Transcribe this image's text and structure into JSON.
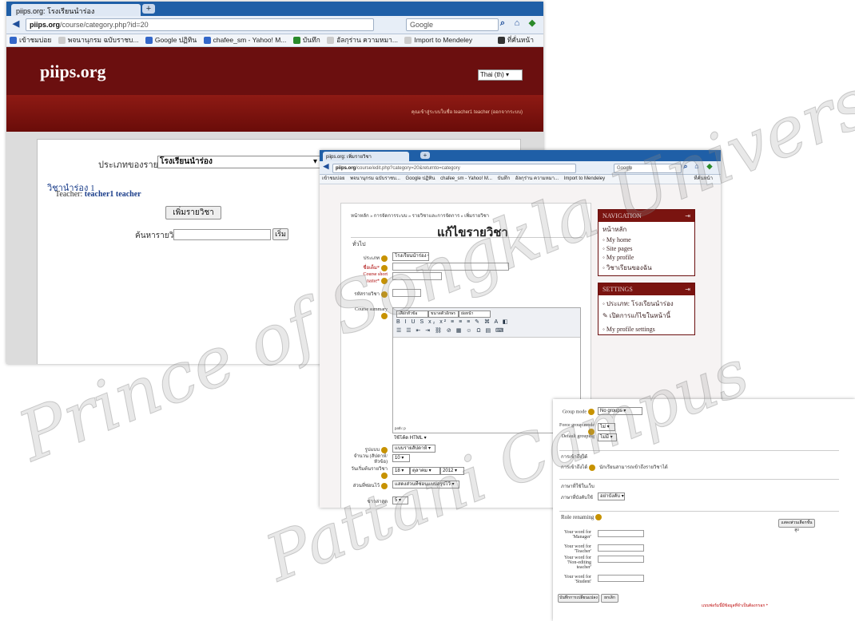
{
  "shot1": {
    "tab_title": "piips.org: โรงเรียนนำร่อง",
    "url_domain": "piips.org",
    "url_path": "/course/category.php?id=20",
    "search_placeholder": "Google",
    "bookmarks": [
      "เข้าชมบ่อย",
      "พจนานุกรม ฉบับราชบ...",
      "Google ปฏิทิน",
      "chafee_sm - Yahoo! M...",
      "บันทึก",
      "อัลกุร่าน ความหมา...",
      "Import to Mendeley",
      "ที่คั่นหน้า"
    ],
    "site_name": "piips.org",
    "language": "Thai (th)",
    "login_info": "คุณเข้าสู่ระบบในชื่อ teacher1 teacher (ออกจากระบบ)",
    "category_label": "ประเภทของรายวิชา:",
    "category_value": "โรงเรียนนำร่อง",
    "course_name": "วิชานำร่อง 1",
    "teacher_label": "Teacher:",
    "teacher_name": "teacher1 teacher",
    "add_course_button": "เพิ่มรายวิชา",
    "search_courses_label": "ค้นหารายวิชา:",
    "go_button": "เริ่ม"
  },
  "shot2": {
    "tab_title": "piips.org: เพิ่มรายวิชา",
    "url_domain": "piips.org",
    "url_path": "/course/edit.php?category=20&returnto=category",
    "search_placeholder": "Google",
    "bookmarks": [
      "เข้าชมบ่อย",
      "พจนานุกรม ฉบับราชบ...",
      "Google ปฏิทิน",
      "chafee_sm - Yahoo! M...",
      "บันทึก",
      "อัลกุร่าน ความหมา...",
      "Import to Mendeley",
      "ที่คั่นหน้า"
    ],
    "breadcrumb": "หน้าหลัก » การจัดการระบบ » รายวิชาและการจัดการ » เพิ่มรายวิชา",
    "page_title": "แก้ไขรายวิชา",
    "section_general": "ทั่วไป",
    "fields": {
      "category_label": "ประเภท",
      "category_value": "โรงเรียนนำร่อง",
      "fullname_label": "ชื่อเต็ม*",
      "shortname_label": "Course short name*",
      "idnumber_label": "รหัสรายวิชา",
      "summary_label": "Course summary",
      "path_label": "path: p",
      "format_text_value": "ใช้โค้ด HTML",
      "format_label": "รูปแบบ",
      "format_value": "แบบรายสัปดาห์",
      "sections_label": "จำนวน (สัปดาห์/หัวข้อ)",
      "sections_value": "10",
      "startdate_label": "วันเริ่มต้นรายวิชา",
      "start_day": "18",
      "start_month": "ตุลาคม",
      "start_year": "2012",
      "hidden_label": "ส่วนที่ซ่อนไว้",
      "hidden_value": "แสดงส่วนที่ซ่อนแบบสรุปไว้",
      "news_label": "ข่าวล่าสุด",
      "news_value": "5"
    },
    "editor_dropdowns": [
      "เลือกหัวข้อ",
      "ขนาดตัวอักษร",
      "ย่อหน้า"
    ],
    "nav_block": {
      "title": "NAVIGATION",
      "items": [
        "หน้าหลัก",
        "My home",
        "Site pages",
        "My profile",
        "วิชาเรียนของฉัน"
      ]
    },
    "settings_block": {
      "title": "SETTINGS",
      "items": [
        "ประเภท: โรงเรียนนำร่อง",
        "เปิดการแก้ไขในหน้านี้",
        "My profile settings"
      ]
    }
  },
  "shot3": {
    "group_mode_label": "Group mode",
    "group_mode_value": "No groups",
    "force_label": "Force group mode",
    "force_value": "ไม่",
    "default_grouping_label": "Default grouping",
    "default_grouping_value": "ไม่มี",
    "availability_section": "การเข้าถึงได้",
    "availability_label": "การเข้าถึงได้",
    "availability_value": "นักเรียนสามารถเข้าถึงรายวิชาได้",
    "language_section": "ภาษาที่ใช้ในเว็บ",
    "force_language_label": "ภาษาที่บังคับใช้",
    "force_language_value": "อย่าบังคับ",
    "role_renaming_section": "Role renaming",
    "show_advanced_button": "แสดงส่วนเลือกขั้นสูง",
    "role_labels": [
      "Your word for 'Manager'",
      "Your word for 'Teacher'",
      "Your word for 'Non-editing teacher'",
      "Your word for 'Student'"
    ],
    "save_button": "บันทึกการเปลี่ยนแปลง",
    "cancel_button": "ยกเลิก",
    "required_note": "แบบฟอร์มนี้มีข้อมูลที่จำเป็นต้องกรอก *"
  },
  "watermark": {
    "line1": "Prince of Songkla University",
    "line2": "Pattani Campus"
  },
  "colors": {
    "maroon": "#6b0f0f",
    "link": "#1a3d8a",
    "accent": "#1f5fa7"
  }
}
